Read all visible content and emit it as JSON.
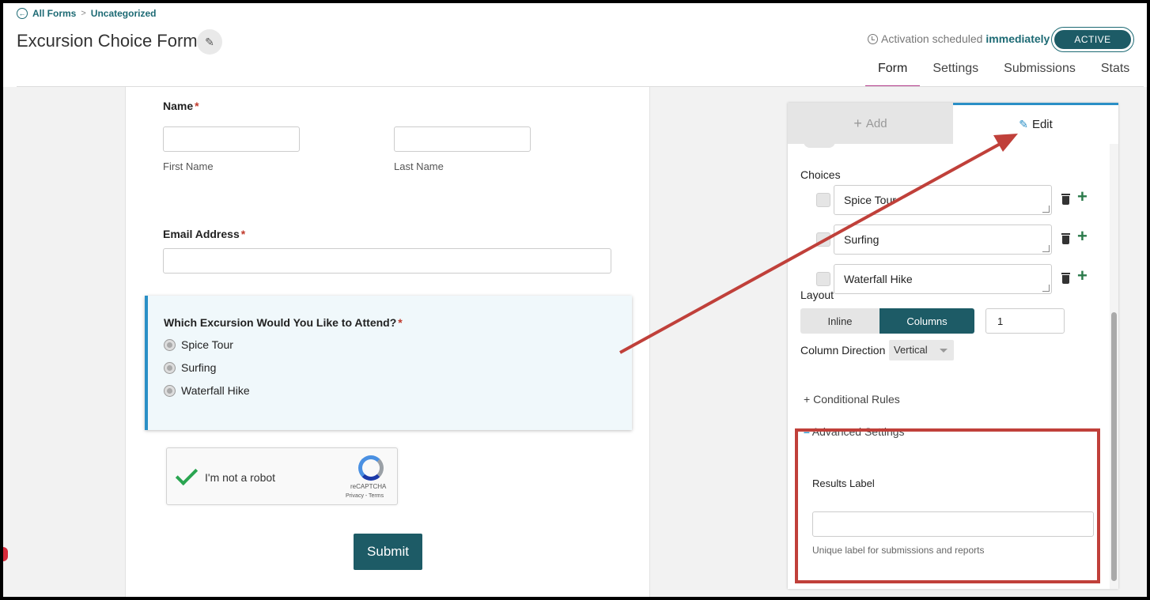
{
  "breadcrumb": {
    "all_forms": "All Forms",
    "separator": ">",
    "category": "Uncategorized"
  },
  "header": {
    "title": "Excursion Choice Form",
    "activation_prefix": "Activation scheduled",
    "activation_value": "immediately",
    "status": "ACTIVE",
    "tabs": [
      {
        "label": "Form"
      },
      {
        "label": "Settings"
      },
      {
        "label": "Submissions"
      },
      {
        "label": "Stats"
      }
    ],
    "active_tab": "Form"
  },
  "form": {
    "name_label": "Name",
    "required_mark": "*",
    "first_name": "First Name",
    "last_name": "Last Name",
    "email_label": "Email Address",
    "question": "Which Excursion Would You Like to Attend?",
    "options": [
      "Spice Tour",
      "Surfing",
      "Waterfall Hike"
    ],
    "recaptcha_text": "I'm not a robot",
    "recaptcha_brand": "reCAPTCHA",
    "recaptcha_terms": "Privacy - Terms",
    "submit": "Submit"
  },
  "panel": {
    "tab_add": "Add",
    "tab_edit": "Edit",
    "choices_label": "Choices",
    "choices": [
      "Spice Tour",
      "Surfing",
      "Waterfall Hike"
    ],
    "layout_label": "Layout",
    "layout_inline": "Inline",
    "layout_columns": "Columns",
    "columns_count": "1",
    "column_direction_label": "Column Direction",
    "column_direction_value": "Vertical",
    "conditional_rules": "Conditional Rules",
    "advanced_settings": "Advanced Settings",
    "results_label": "Results Label",
    "results_help": "Unique label for submissions and reports"
  },
  "colors": {
    "accent": "#1d5b66",
    "link": "#1d6a74",
    "annotation": "#c0403a"
  }
}
